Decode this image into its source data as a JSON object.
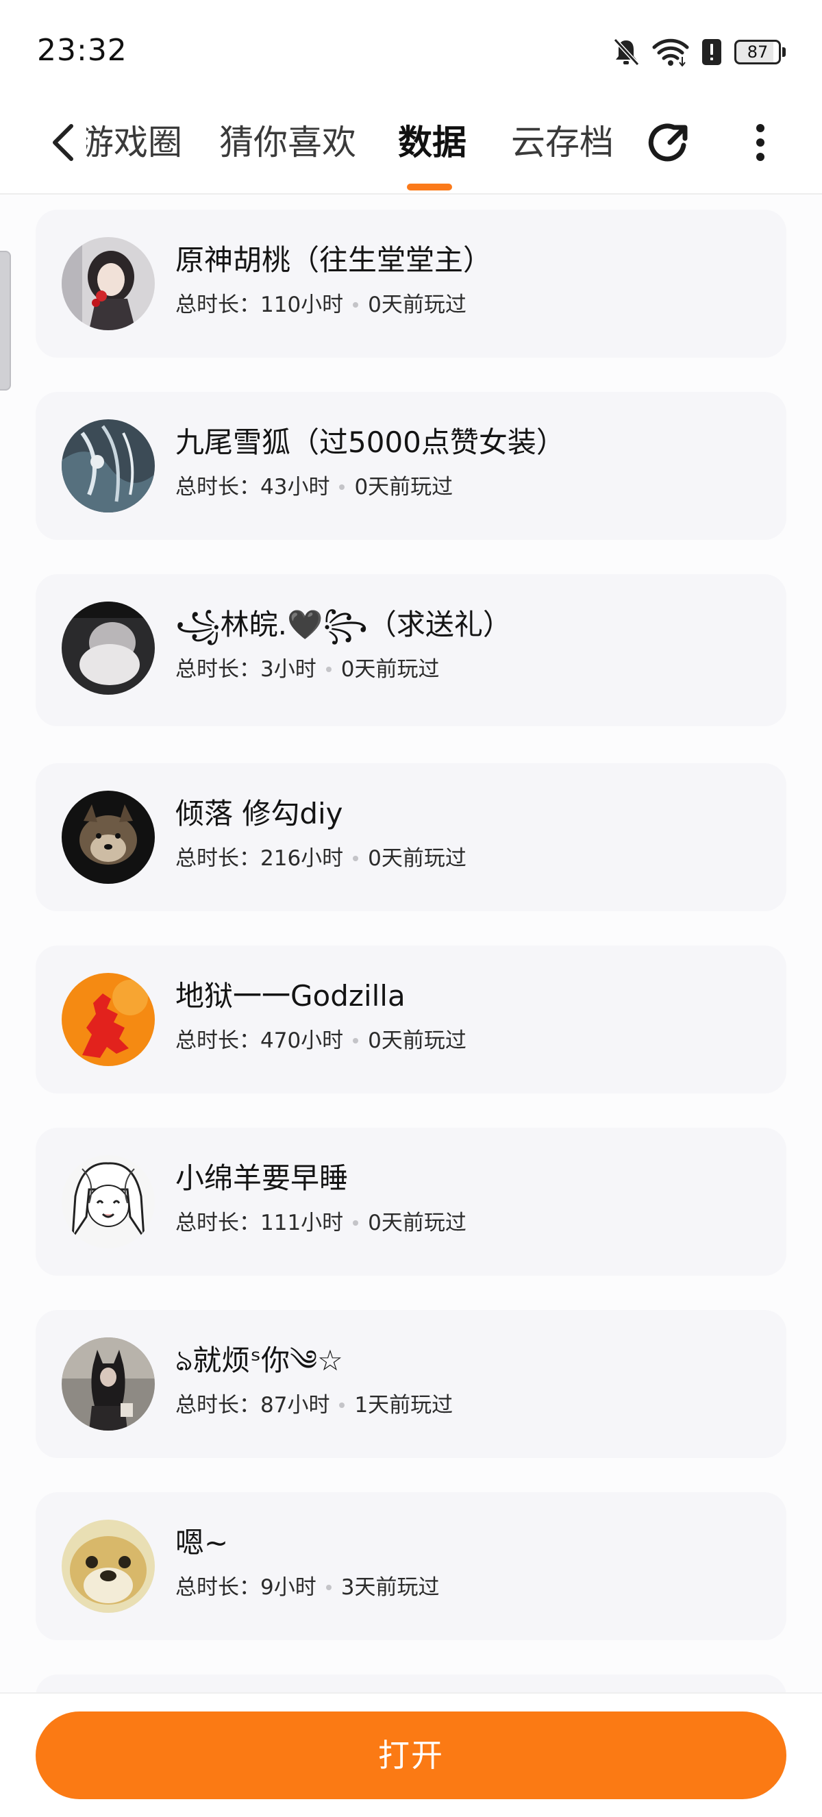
{
  "status_bar": {
    "time": "23:32",
    "battery": "87",
    "icons": [
      "bell-muted-icon",
      "wifi-icon",
      "alert-icon",
      "battery-icon"
    ]
  },
  "header": {
    "back_icon": "chevron-left-icon",
    "tabs": [
      {
        "label": "游戏圈"
      },
      {
        "label": "猜你喜欢"
      },
      {
        "label": "数据"
      },
      {
        "label": "云存档"
      }
    ],
    "active_tab": "数据",
    "accent_color": "#fb7a1a",
    "share_icon": "share-icon",
    "more_icon": "more-vertical-icon"
  },
  "players": [
    {
      "name": "原神胡桃（往生堂堂主）",
      "duration": "总时长：110小时",
      "last_played": "0天前玩过"
    },
    {
      "name": "九尾雪狐（过5000点赞女装）",
      "duration": "总时长：43小时",
      "last_played": "0天前玩过"
    },
    {
      "name": "꧁林皖.🖤꧂（求送礼）",
      "duration": "总时长：3小时",
      "last_played": "0天前玩过"
    },
    {
      "name": "倾落 修勾diy",
      "duration": "总时长：216小时",
      "last_played": "0天前玩过"
    },
    {
      "name": "地狱一一Godzilla",
      "duration": "总时长：470小时",
      "last_played": "0天前玩过"
    },
    {
      "name": "小绵羊要早睡",
      "duration": "总时长：111小时",
      "last_played": "0天前玩过"
    },
    {
      "name": "ঌ就烦ˢ你༄☆",
      "duration": "总时长：87小时",
      "last_played": "1天前玩过"
    },
    {
      "name": "嗯~",
      "duration": "总时长：9小时",
      "last_played": "3天前玩过"
    }
  ],
  "bottom": {
    "open_label": "打开",
    "button_color": "#fb7a14"
  }
}
